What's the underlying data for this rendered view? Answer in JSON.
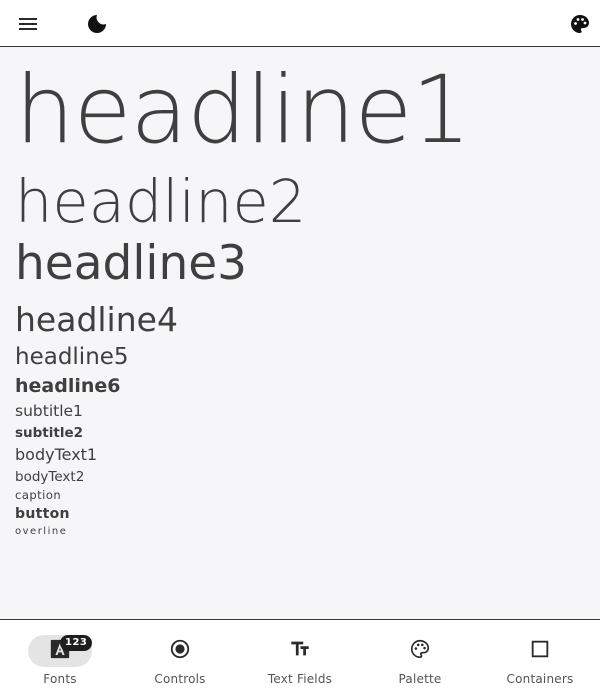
{
  "typography": {
    "headline1": "headline1",
    "headline2": "headline2",
    "headline3": "headline3",
    "headline4": "headline4",
    "headline5": "headline5",
    "headline6": "headline6",
    "subtitle1": "subtitle1",
    "subtitle2": "subtitle2",
    "bodyText1": "bodyText1",
    "bodyText2": "bodyText2",
    "caption": "caption",
    "button": "button",
    "overline": "overline"
  },
  "topbar": {
    "menu_icon": "menu-icon",
    "theme_icon": "dark-mode-moon-icon",
    "palette_icon": "palette-icon"
  },
  "bottom_nav": {
    "items": [
      {
        "label": "Fonts",
        "icon": "font-a-icon",
        "badge": "123",
        "active": true
      },
      {
        "label": "Controls",
        "icon": "radio-button-icon",
        "active": false
      },
      {
        "label": "Text Fields",
        "icon": "text-fields-icon",
        "active": false
      },
      {
        "label": "Palette",
        "icon": "palette-icon",
        "active": false
      },
      {
        "label": "Containers",
        "icon": "square-outline-icon",
        "active": false
      }
    ]
  },
  "colors": {
    "background": "#f6f5f7",
    "surface": "#ffffff",
    "text": "#3f3f3f",
    "badge": "#1e1e1e",
    "active_pill": "#e4e4e4"
  }
}
